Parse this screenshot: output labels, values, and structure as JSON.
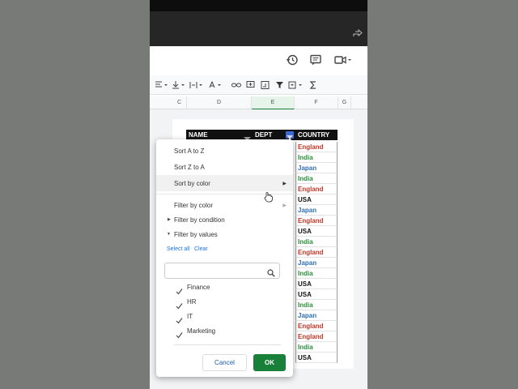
{
  "columns": [
    "C",
    "D",
    "E",
    "F",
    "G"
  ],
  "headers": {
    "name": "NAME",
    "dept": "DEPT",
    "country": "COUNTRY"
  },
  "countries": [
    {
      "text": "England",
      "color": "#c0392b"
    },
    {
      "text": "India",
      "color": "#2e8b3c"
    },
    {
      "text": "Japan",
      "color": "#2f6fb0"
    },
    {
      "text": "India",
      "color": "#2e8b3c"
    },
    {
      "text": "England",
      "color": "#c0392b"
    },
    {
      "text": "USA",
      "color": "#111111"
    },
    {
      "text": "Japan",
      "color": "#2f6fb0"
    },
    {
      "text": "England",
      "color": "#c0392b"
    },
    {
      "text": "USA",
      "color": "#111111"
    },
    {
      "text": "India",
      "color": "#2e8b3c"
    },
    {
      "text": "England",
      "color": "#c0392b"
    },
    {
      "text": "Japan",
      "color": "#2f6fb0"
    },
    {
      "text": "India",
      "color": "#2e8b3c"
    },
    {
      "text": "USA",
      "color": "#111111"
    },
    {
      "text": "USA",
      "color": "#111111"
    },
    {
      "text": "India",
      "color": "#2e8b3c"
    },
    {
      "text": "Japan",
      "color": "#2f6fb0"
    },
    {
      "text": "England",
      "color": "#c0392b"
    },
    {
      "text": "England",
      "color": "#c0392b"
    },
    {
      "text": "India",
      "color": "#2e8b3c"
    },
    {
      "text": "USA",
      "color": "#111111"
    }
  ],
  "menu": {
    "sort_az": "Sort A to Z",
    "sort_za": "Sort Z to A",
    "sort_color": "Sort by color",
    "filter_color": "Filter by color",
    "filter_condition": "Filter by condition",
    "filter_values": "Filter by values",
    "select_all": "Select all",
    "clear": "Clear",
    "search_placeholder": "",
    "values": [
      "Finance",
      "HR",
      "IT",
      "Marketing"
    ],
    "cancel": "Cancel",
    "ok": "OK"
  },
  "colors": {
    "ok_green": "#188038",
    "header_black": "#111111",
    "selected_col": "#e6f4ea"
  }
}
